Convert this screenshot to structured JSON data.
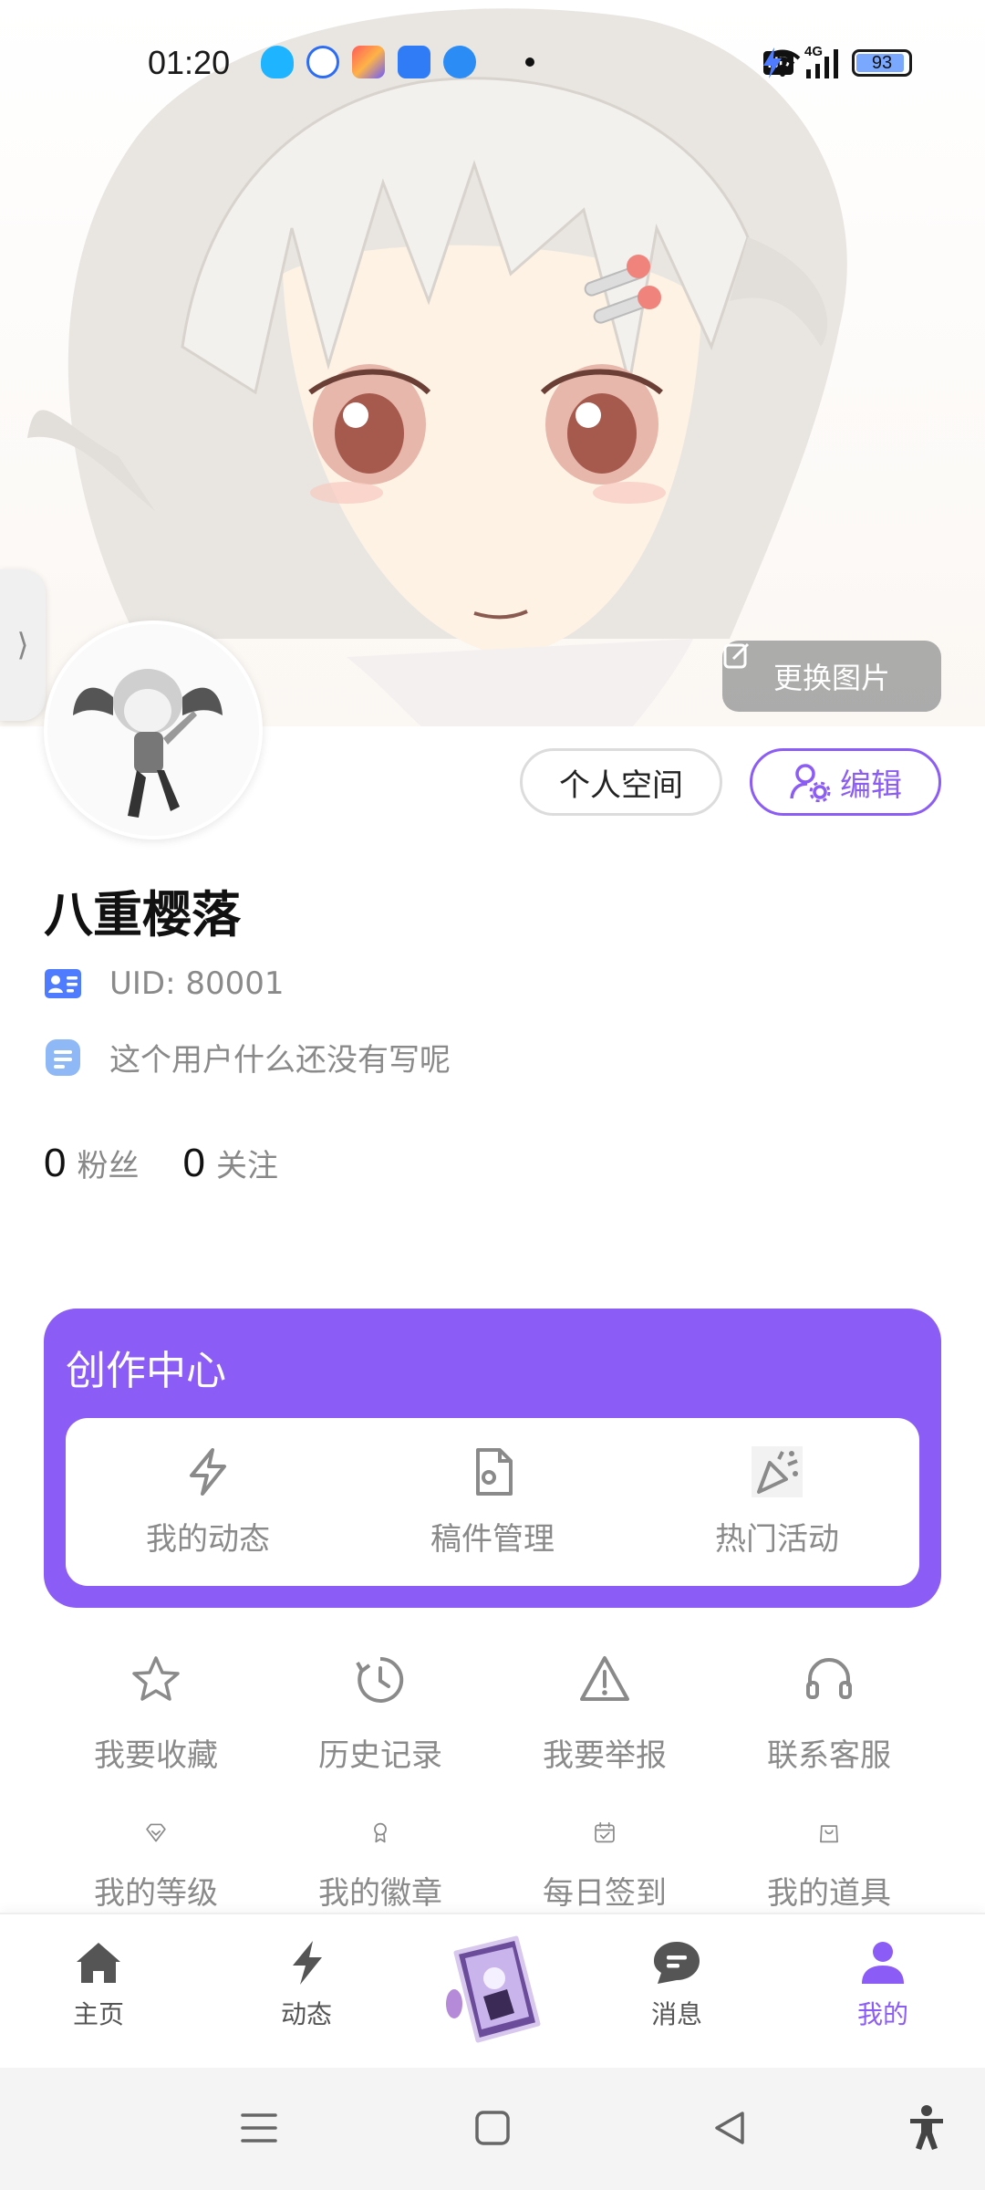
{
  "status_bar": {
    "time": "01:20",
    "battery": "93",
    "battery_level": 0.93,
    "network": "4G",
    "hd_label": "HD"
  },
  "banner": {
    "change_image_label": "更换图片"
  },
  "profile": {
    "username": "八重樱落",
    "uid": "UID: 80001",
    "bio": "这个用户什么还没有写呢",
    "space_button": "个人空间",
    "edit_button": "编辑",
    "stats": [
      {
        "count": "0",
        "label": "粉丝"
      },
      {
        "count": "0",
        "label": "关注"
      }
    ]
  },
  "creator_center": {
    "title": "创作中心",
    "items": [
      {
        "label": "我的动态",
        "icon": "lightning-icon"
      },
      {
        "label": "稿件管理",
        "icon": "file-settings-icon"
      },
      {
        "label": "热门活动",
        "icon": "party-popper-icon"
      }
    ]
  },
  "menu_grid": {
    "row1": [
      {
        "label": "我要收藏",
        "icon": "star-icon"
      },
      {
        "label": "历史记录",
        "icon": "history-icon"
      },
      {
        "label": "我要举报",
        "icon": "warning-icon"
      },
      {
        "label": "联系客服",
        "icon": "headset-icon"
      }
    ],
    "row2": [
      {
        "label": "我的等级",
        "icon": "diamond-icon"
      },
      {
        "label": "我的徽章",
        "icon": "badge-icon"
      },
      {
        "label": "每日签到",
        "icon": "calendar-check-icon"
      },
      {
        "label": "我的道具",
        "icon": "shopping-bag-icon"
      }
    ]
  },
  "tab_bar": {
    "items": [
      {
        "label": "主页",
        "icon": "home-icon"
      },
      {
        "label": "动态",
        "icon": "lightning-icon"
      },
      {
        "label": "消息",
        "icon": "message-icon"
      },
      {
        "label": "我的",
        "icon": "person-icon",
        "active": true
      }
    ]
  },
  "colors": {
    "accent": "#8b5cf6",
    "muted_text": "#8a8a8a",
    "uid_icon": "#4f7cff"
  }
}
